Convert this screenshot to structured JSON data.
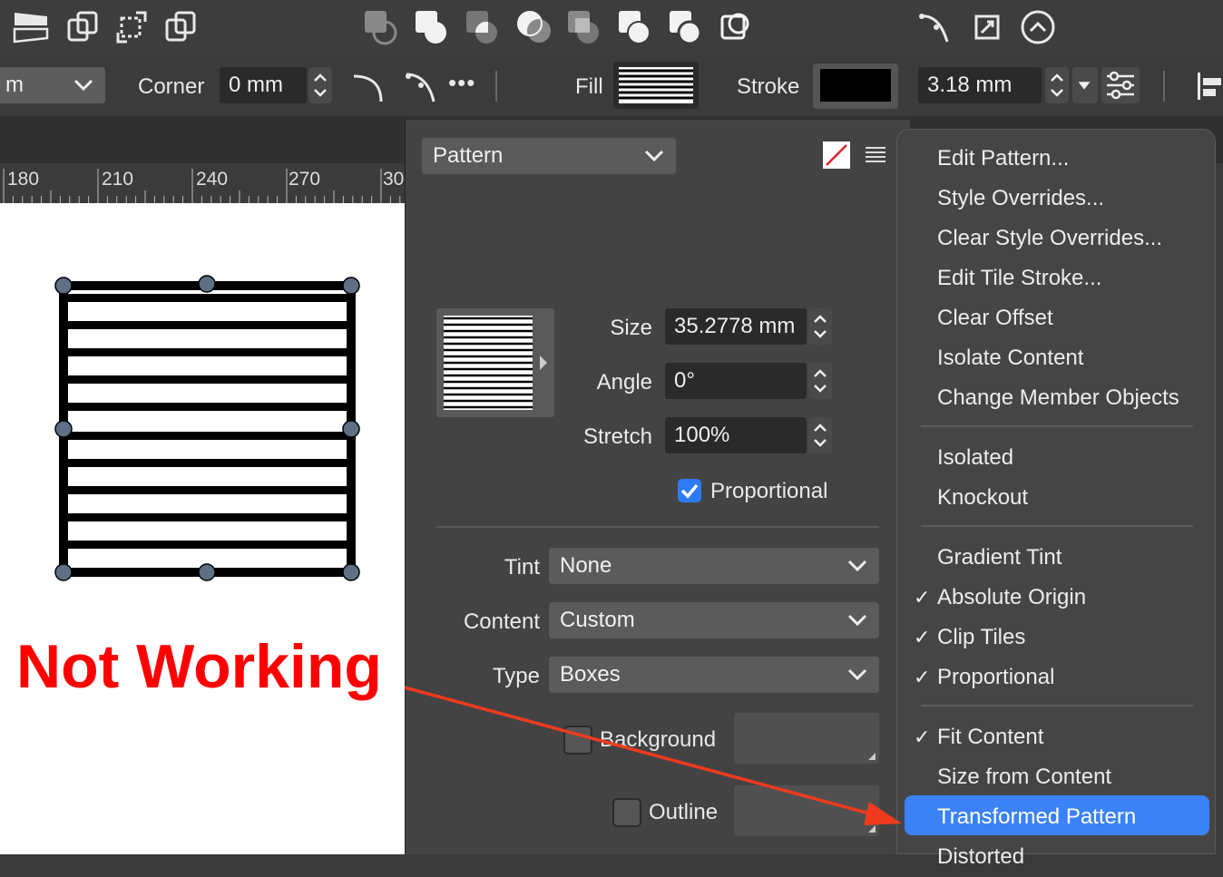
{
  "toolbar": {
    "icons": [
      "flip-icon",
      "rotate-left-icon",
      "align-icon",
      "rotate-right-icon",
      "subtract-icon",
      "add-icon",
      "intersect-icon",
      "xor-icon",
      "divide-icon",
      "combine-icon",
      "clip-icon",
      "insert-icon",
      "node-icon",
      "transform-icon",
      "snap-icon"
    ]
  },
  "context_bar": {
    "unit_value": "m",
    "corner_label": "Corner",
    "corner_value": "0 mm",
    "fill_label": "Fill",
    "stroke_label": "Stroke",
    "stroke_width": "3.18 mm",
    "more_label": "•••"
  },
  "ruler": {
    "ticks": [
      "180",
      "210",
      "240",
      "270",
      "30"
    ]
  },
  "annotation": {
    "text": "Not Working",
    "color": "#ff0000"
  },
  "panel": {
    "mode": "Pattern",
    "size_label": "Size",
    "size_value": "35.2778 mm",
    "angle_label": "Angle",
    "angle_value": "0°",
    "stretch_label": "Stretch",
    "stretch_value": "100%",
    "proportional_label": "Proportional",
    "proportional_checked": true,
    "tint_label": "Tint",
    "tint_value": "None",
    "content_label": "Content",
    "content_value": "Custom",
    "type_label": "Type",
    "type_value": "Boxes",
    "background_label": "Background",
    "outline_label": "Outline"
  },
  "menu": {
    "items": [
      {
        "label": "Edit Pattern...",
        "checked": false
      },
      {
        "label": "Style Overrides...",
        "checked": false
      },
      {
        "label": "Clear Style Overrides...",
        "checked": false
      },
      {
        "label": "Edit Tile Stroke...",
        "checked": false
      },
      {
        "label": "Clear Offset",
        "checked": false
      },
      {
        "label": "Isolate Content",
        "checked": false
      },
      {
        "label": "Change Member Objects",
        "checked": false
      },
      {
        "label": "Isolated",
        "checked": false
      },
      {
        "label": "Knockout",
        "checked": false
      },
      {
        "label": "Gradient Tint",
        "checked": false
      },
      {
        "label": "Absolute Origin",
        "checked": true
      },
      {
        "label": "Clip Tiles",
        "checked": true
      },
      {
        "label": "Proportional",
        "checked": true
      },
      {
        "label": "Fit Content",
        "checked": true
      },
      {
        "label": "Size from Content",
        "checked": false
      },
      {
        "label": "Transformed Pattern",
        "checked": false,
        "selected": true
      },
      {
        "label": "Distorted",
        "checked": false
      }
    ],
    "check_glyph": "✓"
  },
  "colors": {
    "accent": "#3b82f6",
    "annotation": "#ff0000",
    "arrow": "#f03a1e"
  }
}
